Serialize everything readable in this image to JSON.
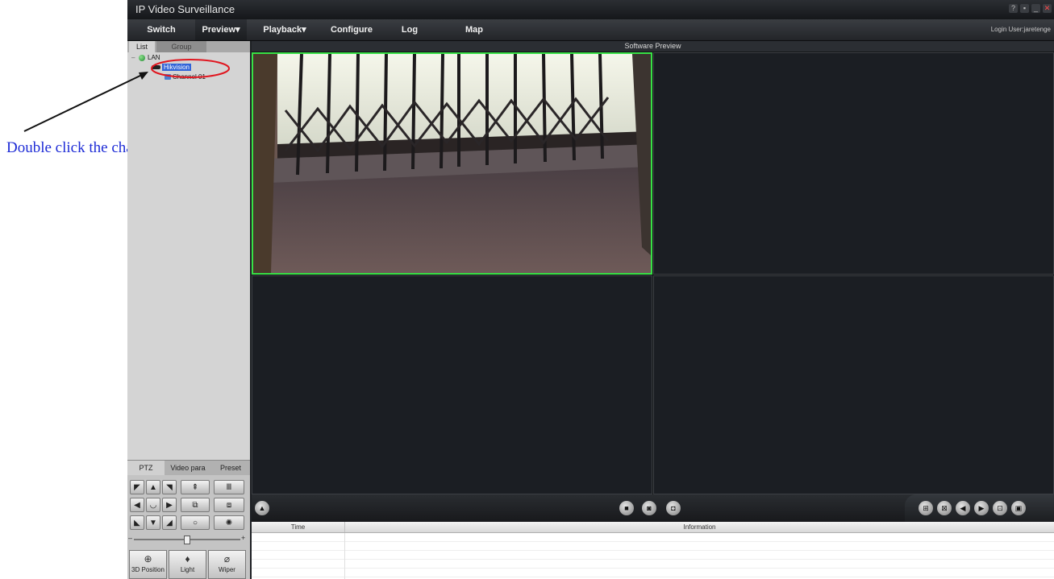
{
  "annotation": {
    "text": "Double click the channel",
    "color": "#1d2bd6",
    "highlight_color": "#e0161f"
  },
  "window": {
    "title": "IP Video Surveillance",
    "controls": [
      "?",
      "lock",
      "minimize",
      "close"
    ]
  },
  "menu": {
    "items": [
      "Switch",
      "Preview▾",
      "Playback▾",
      "Configure",
      "Log",
      "Map"
    ],
    "active": "Preview▾",
    "login": "Login User:jaretenge"
  },
  "left_panel": {
    "tabs": [
      "List",
      "Group"
    ],
    "active_tab": "List",
    "tree": {
      "root": "LAN",
      "device": "Hikvision",
      "channel": "Channel 01"
    },
    "ptz_tabs": [
      "PTZ",
      "Video para",
      "Preset"
    ],
    "ptz_slider_level": 0.5,
    "ptz_bottom_buttons": [
      "3D Position",
      "Light",
      "Wiper"
    ]
  },
  "preview": {
    "title": "Software Preview",
    "active_pane_color": "#38e046",
    "panes": 4,
    "playing_pane": 1
  },
  "log": {
    "columns": [
      "Time",
      "Information"
    ]
  }
}
